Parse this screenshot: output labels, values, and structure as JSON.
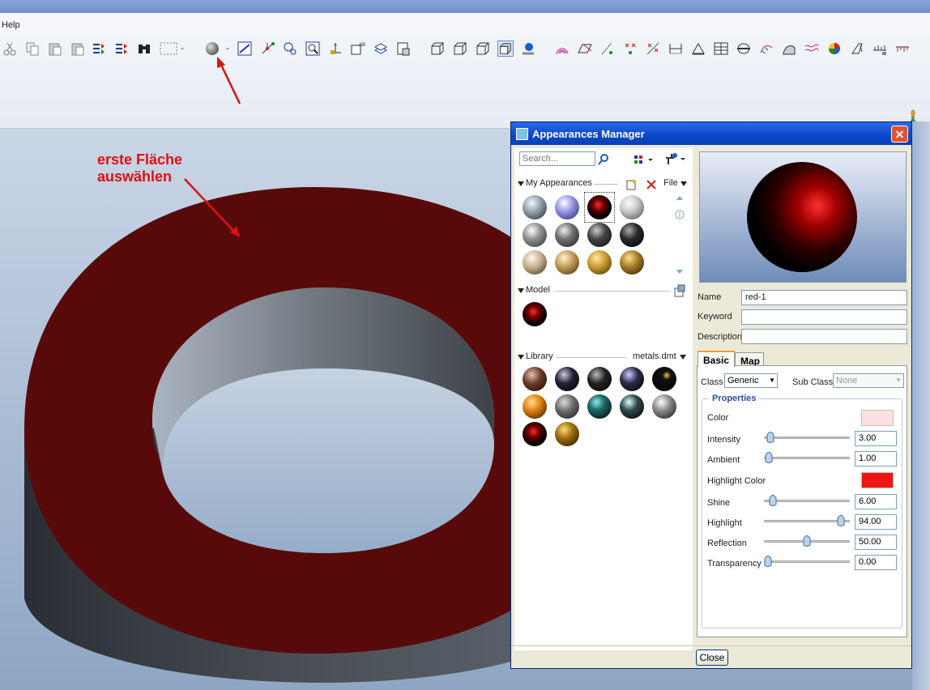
{
  "menu": {
    "help": "Help"
  },
  "annotation": {
    "text": "erste Fläche\nauswählen"
  },
  "dialog": {
    "title": "Appearances Manager",
    "close_glyph": "✕",
    "search_placeholder": "Search...",
    "sections": {
      "my_appearances": "My Appearances",
      "model": "Model",
      "library": "Library",
      "library_file": "metals.dmt",
      "file_menu": "File"
    },
    "name_label": "Name",
    "name_value": "red-1",
    "keyword_label": "Keyword",
    "description_label": "Description",
    "tabs": {
      "basic": "Basic",
      "map": "Map"
    },
    "class_label": "Class",
    "class_value": "Generic",
    "subclass_label": "Sub Class",
    "subclass_value": "None",
    "properties_title": "Properties",
    "properties": {
      "color": {
        "label": "Color",
        "swatch": "#fde0e4"
      },
      "intensity": {
        "label": "Intensity",
        "value": "3.00",
        "level": 0.03
      },
      "ambient": {
        "label": "Ambient",
        "value": "1.00",
        "level": 0.01
      },
      "highlight_color": {
        "label": "Highlight Color",
        "swatch": "#f01414"
      },
      "shine": {
        "label": "Shine",
        "value": "6.00",
        "level": 0.06
      },
      "highlight": {
        "label": "Highlight",
        "value": "94.00",
        "level": 0.94
      },
      "reflection": {
        "label": "Reflection",
        "value": "50.00",
        "level": 0.5
      },
      "transparency": {
        "label": "Transparency",
        "value": "0.00",
        "level": 0.0
      }
    },
    "close_button": "Close"
  },
  "colors": {
    "accent": "#0a46c8",
    "ring_top": "#580a0a",
    "annotation": "#e01010"
  }
}
